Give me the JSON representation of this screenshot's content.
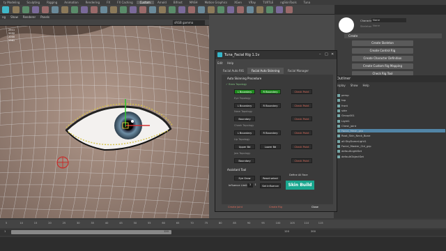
{
  "shelf_tabs": [
    "ty Modeling",
    "Sculpting",
    "Rigging",
    "Animation",
    "Rendering",
    "FX",
    "FX Caching",
    "Custom",
    "Arnold",
    "Bifrost",
    "MASH",
    "Motion Graphics",
    "XGen",
    "VRay",
    "TURTLE",
    "ngSkinTools",
    "Tuna"
  ],
  "shelf_active": "Custom",
  "viewport_menu": [
    "Show",
    "Renderer",
    "Panels"
  ],
  "viewport_menu_prefix": "ng",
  "gamma": "sRGB gamma",
  "hud_values": [
    "2511",
    "2032",
    "2000",
    "1961"
  ],
  "char_panel": {
    "character_label": "Character",
    "character_value": "None",
    "skeleton_label": "Skeleton",
    "skeleton_value": "None",
    "create_label": "Create",
    "buttons": [
      "Create Skeleton",
      "Create Control Rig",
      "Create Character Definition",
      "Create Custom Rig Mapping",
      "Check Rig Tool"
    ]
  },
  "tuna": {
    "title": "Tuna_Facial Rig 1.1v",
    "menu": [
      "Edit",
      "Help"
    ],
    "tabs": [
      "Facial Auto RIG",
      "Facial Auto Skinning",
      "Facial Manager"
    ],
    "section_title": "Auto Skinning Procedure",
    "brow_topology": "Brow Topology",
    "l_boundary": "L Boundary",
    "r_boundary": "R Boundary",
    "check_paint": "Check Paint",
    "eye_topology": "Eye Topology",
    "nose_topology": "Nose Topology",
    "boundary": "Boundary",
    "cheek_topology": "Cheek Topology",
    "lip_topology": "Lip Topology",
    "upper_bd": "Upper Bd",
    "lower_bd": "Lower Bd",
    "jaw_topology": "Jaw Topology",
    "assistant_title": "Assistant Tool",
    "eye_grow": "Eye Grow",
    "reset_select": "Reset select",
    "define_all_face": "Define All Face",
    "influence_limit": "Influence Limit",
    "influence_value": "3",
    "set_influence": "Set Influence",
    "skin_build": "Skin Build",
    "footer": [
      "Create Joint",
      "Create Rig",
      "Close"
    ]
  },
  "outliner": {
    "title": "Outliner",
    "menu": [
      "Display",
      "Show",
      "Help"
    ],
    "items": [
      "persp",
      "top",
      "front",
      "side",
      "Group001",
      "Light1",
      "Chest_joint",
      "Facial_Mesh_grp",
      "Root_Skin_Neck_Bone",
      "all:SkyDomeLight1",
      "Facial_Master_Ctrl_grp",
      "defaultLightSet",
      "defaultObjectSet"
    ],
    "selected": "Facial_Mesh_grp"
  },
  "timeline": {
    "ticks": [
      "5",
      "10",
      "15",
      "20",
      "25",
      "30",
      "35",
      "40",
      "45",
      "50",
      "55",
      "60",
      "65",
      "70",
      "75",
      "80",
      "85",
      "90",
      "95",
      "100",
      "105",
      "110",
      "115"
    ],
    "range_start": "1",
    "range_end": "120",
    "current": "1",
    "end_a": "120",
    "end_b": "200"
  },
  "colors": {
    "green": "#1e8a1e",
    "skin_build": "#1aa78f",
    "selected_row": "#5285a6"
  }
}
